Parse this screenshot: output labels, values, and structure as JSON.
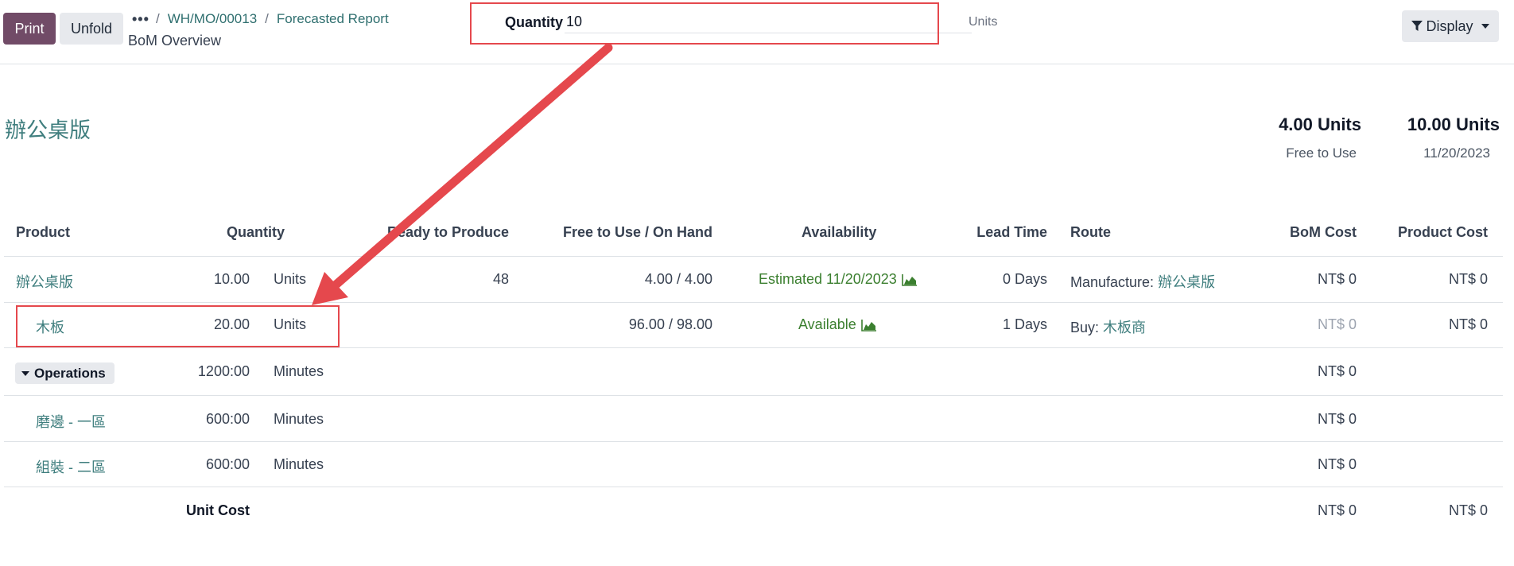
{
  "toolbar": {
    "print_label": "Print",
    "unfold_label": "Unfold",
    "ellipsis": "•••",
    "breadcrumb": [
      {
        "label": "WH/MO/00013"
      },
      {
        "label": "Forecasted Report"
      }
    ],
    "breadcrumb_sep": "/",
    "current_page": "BoM Overview"
  },
  "quantity": {
    "label": "Quantity",
    "value": "10",
    "unit": "Units"
  },
  "display_button": {
    "label": "Display",
    "icon": "filter-icon"
  },
  "product": {
    "name": "辦公桌版",
    "free_to_use_value": "4.00 Units",
    "free_to_use_label": "Free to Use",
    "forecast_value": "10.00 Units",
    "forecast_date": "11/20/2023"
  },
  "table": {
    "headers": {
      "product": "Product",
      "quantity": "Quantity",
      "ready": "Ready to Produce",
      "free_on_hand": "Free to Use / On Hand",
      "availability": "Availability",
      "lead_time": "Lead Time",
      "route": "Route",
      "bom_cost": "BoM Cost",
      "product_cost": "Product Cost"
    },
    "rows": [
      {
        "product": "辦公桌版",
        "quantity": "10.00",
        "unit": "Units",
        "ready": "48",
        "free_on_hand": "4.00 / 4.00",
        "availability": "Estimated 11/20/2023",
        "lead_time": "0 Days",
        "route_prefix": "Manufacture:",
        "route_link": "辦公桌版",
        "bom_cost": "NT$ 0",
        "product_cost": "NT$ 0"
      },
      {
        "product": "木板",
        "quantity": "20.00",
        "unit": "Units",
        "ready": "",
        "free_on_hand": "96.00 / 98.00",
        "availability": "Available",
        "lead_time": "1 Days",
        "route_prefix": "Buy:",
        "route_link": "木板商",
        "bom_cost": "NT$ 0",
        "product_cost": "NT$ 0"
      }
    ],
    "operations": {
      "label": "Operations",
      "quantity": "1200:00",
      "unit": "Minutes",
      "bom_cost": "NT$ 0",
      "items": [
        {
          "name": "磨邊 - 一區",
          "quantity": "600:00",
          "unit": "Minutes",
          "bom_cost": "NT$ 0"
        },
        {
          "name": "組裝 - 二區",
          "quantity": "600:00",
          "unit": "Minutes",
          "bom_cost": "NT$ 0"
        }
      ]
    },
    "unit_cost": {
      "label": "Unit Cost",
      "bom_cost": "NT$ 0",
      "product_cost": "NT$ 0"
    }
  },
  "colors": {
    "brand": "#714B67",
    "link": "#3f7e7e",
    "success": "#3b7f2f",
    "annotation": "#e5484d"
  }
}
